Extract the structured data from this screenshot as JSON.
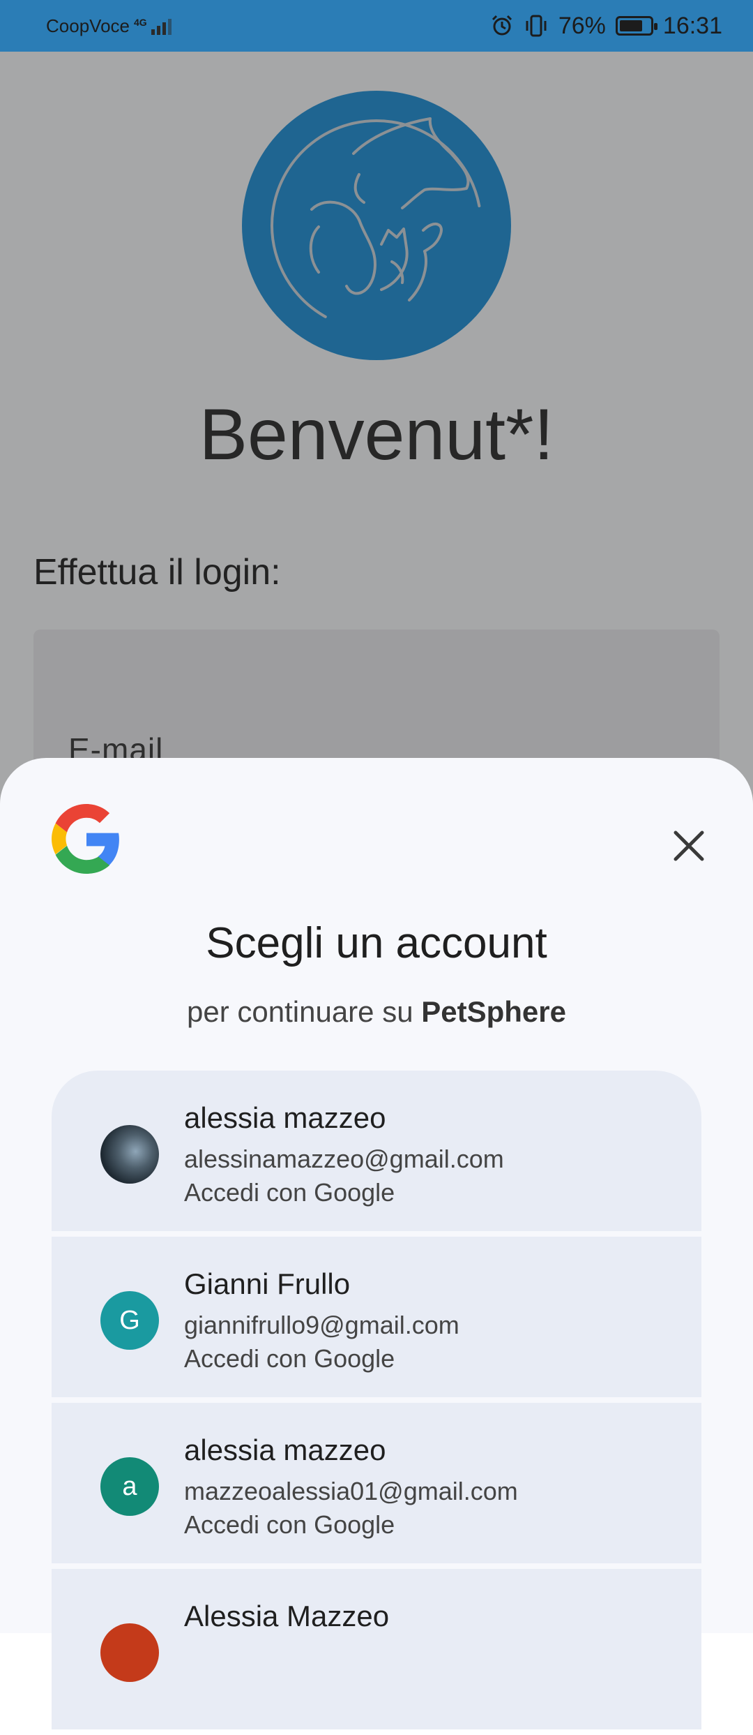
{
  "status_bar": {
    "carrier": "CoopVoce",
    "network": "4G",
    "battery": "76%",
    "battery_level": 0.76,
    "time": "16:31"
  },
  "app": {
    "welcome_title": "Benvenut*!",
    "login_prompt": "Effettua il login:",
    "email_placeholder": "E-mail",
    "logo_color": "#2e96d6"
  },
  "sheet": {
    "title": "Scegli un account",
    "subtitle_prefix": "per continuare su",
    "app_name": "PetSphere",
    "accounts": [
      {
        "name": "alessia mazzeo",
        "email": "alessinamazzeo@gmail.com",
        "action": "Accedi con Google",
        "avatar_type": "photo"
      },
      {
        "name": "Gianni Frullo",
        "email": "giannifrullo9@gmail.com",
        "action": "Accedi con Google",
        "avatar_letter": "G",
        "avatar_color": "#1a9aa0"
      },
      {
        "name": "alessia mazzeo",
        "email": "mazzeoalessia01@gmail.com",
        "action": "Accedi con Google",
        "avatar_letter": "a",
        "avatar_color": "#128a76"
      },
      {
        "name": "Alessia Mazzeo",
        "avatar_color": "#c43a1a"
      }
    ]
  }
}
